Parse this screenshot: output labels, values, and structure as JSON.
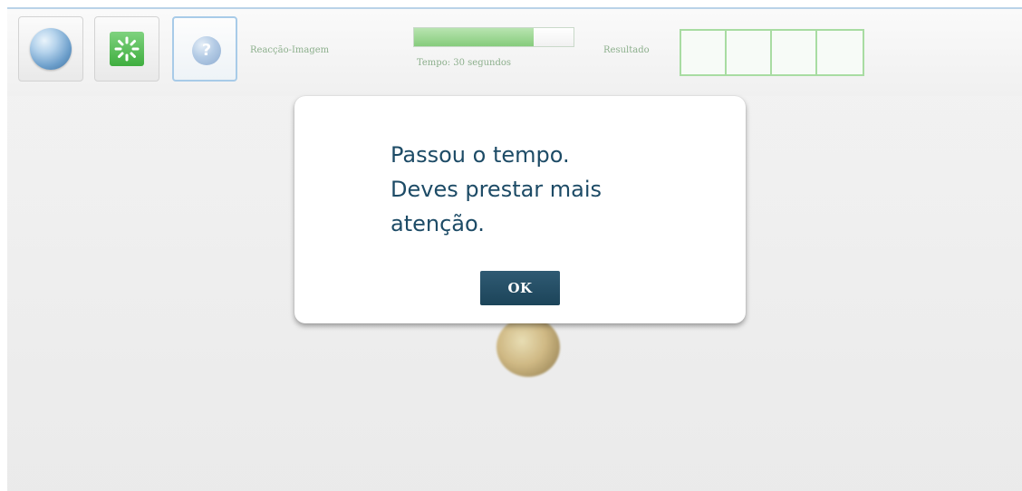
{
  "toolbar": {
    "buttons": [
      {
        "name": "globe-icon"
      },
      {
        "name": "loading-icon"
      },
      {
        "name": "help-icon",
        "glyph": "?"
      }
    ],
    "reaction_label": "Reacção-Imagem",
    "timer": {
      "label": "Tempo: 30 segundos",
      "progress_percent": 75
    },
    "result": {
      "label": "Resultado",
      "slots": [
        "",
        "",
        "",
        ""
      ]
    }
  },
  "dialog": {
    "message_lines": [
      "Passou o tempo.",
      "Deves prestar mais",
      "atenção."
    ],
    "ok_label": "OK"
  },
  "colors": {
    "dialog_text": "#1d4b66",
    "ok_button": "#2f5a73",
    "progress_fill": "#86cc7c",
    "result_border": "#a8dca2"
  }
}
